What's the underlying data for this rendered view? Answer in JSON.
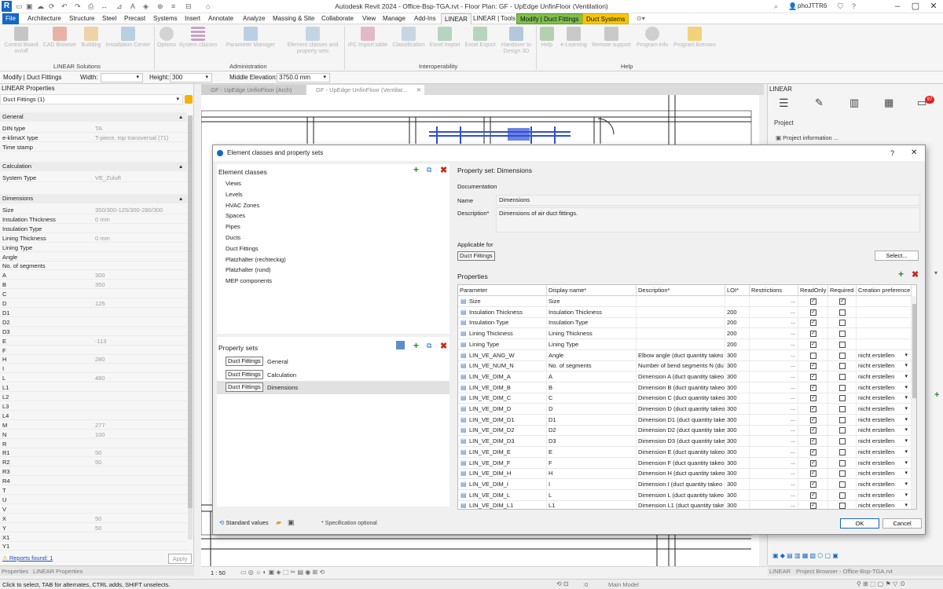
{
  "app": {
    "title": "Autodesk Revit 2024 - Office-Bsp-TGA.rvt - Floor Plan: GF - UpEdge UnfinFloor (Ventilation)",
    "user": "phoJTTR6"
  },
  "ribbon_tabs": [
    "File",
    "Architecture",
    "Structure",
    "Steel",
    "Precast",
    "Systems",
    "Insert",
    "Annotate",
    "Analyze",
    "Massing & Site",
    "Collaborate",
    "View",
    "Manage",
    "Add-Ins",
    "LINEAR",
    "LINEAR | Tools",
    "Modify | Duct Fittings",
    "Duct Systems"
  ],
  "ribbon": {
    "buttons": [
      {
        "label": "Control Board on/off",
        "icon": "control-board-icon"
      },
      {
        "label": "CAD Browser",
        "icon": "cad-browser-icon"
      },
      {
        "label": "Building",
        "icon": "building-icon"
      },
      {
        "label": "Installation Center",
        "icon": "installation-center-icon"
      },
      {
        "label": "Options",
        "icon": "gear-icon"
      },
      {
        "label": "System classes",
        "icon": "system-classes-icon"
      },
      {
        "label": "Parameter Manager",
        "icon": "parameter-manager-icon"
      },
      {
        "label": "Element classes and property sets",
        "icon": "element-classes-icon"
      },
      {
        "label": "IFC Import table",
        "icon": "ifc-import-icon"
      },
      {
        "label": "Classification",
        "icon": "classification-icon"
      },
      {
        "label": "Excel Import",
        "icon": "excel-import-icon"
      },
      {
        "label": "Excel Export",
        "icon": "excel-export-icon"
      },
      {
        "label": "Handover to Design 3D",
        "icon": "handover-icon"
      },
      {
        "label": "Help",
        "icon": "help-icon"
      },
      {
        "label": "e-Learning",
        "icon": "e-learning-icon"
      },
      {
        "label": "Remote support",
        "icon": "remote-support-icon"
      },
      {
        "label": "Program info",
        "icon": "info-icon"
      },
      {
        "label": "Program licenses",
        "icon": "key-icon"
      }
    ],
    "panels": [
      "LINEAR Solutions",
      "Administration",
      "Interoperability",
      "Help"
    ]
  },
  "options_bar": {
    "context": "Modify | Duct Fittings",
    "width_label": "Width:",
    "height_label": "Height:",
    "height_value": "300",
    "elev_label": "Middle Elevation:",
    "elev_value": "3750.0 mm"
  },
  "properties": {
    "header": "LINEAR Properties",
    "type_selector": "Duct Fittings (1)",
    "sections": {
      "general": "General",
      "calculation": "Calculation",
      "dimensions": "Dimensions"
    },
    "general_rows": [
      {
        "k": "DIN type",
        "v": "TA"
      },
      {
        "k": "e-klimaX type",
        "v": "T-piece, top transversal (71)"
      },
      {
        "k": "Time stamp",
        "v": ""
      }
    ],
    "calc_rows": [
      {
        "k": "System Type",
        "v": "VE_Zuluft"
      }
    ],
    "dim_rows": [
      {
        "k": "Size",
        "v": "350/300-125/300-280/300"
      },
      {
        "k": "Insulation Thickness",
        "v": "0 mm"
      },
      {
        "k": "Insulation Type",
        "v": ""
      },
      {
        "k": "Lining Thickness",
        "v": "0 mm"
      },
      {
        "k": "Lining Type",
        "v": ""
      },
      {
        "k": "Angle",
        "v": ""
      },
      {
        "k": "No. of segments",
        "v": ""
      },
      {
        "k": "A",
        "v": "300"
      },
      {
        "k": "B",
        "v": "350"
      },
      {
        "k": "C",
        "v": ""
      },
      {
        "k": "D",
        "v": "125"
      },
      {
        "k": "D1",
        "v": ""
      },
      {
        "k": "D2",
        "v": ""
      },
      {
        "k": "D3",
        "v": ""
      },
      {
        "k": "E",
        "v": "-113"
      },
      {
        "k": "F",
        "v": ""
      },
      {
        "k": "H",
        "v": "280"
      },
      {
        "k": "I",
        "v": ""
      },
      {
        "k": "L",
        "v": "480"
      },
      {
        "k": "L1",
        "v": ""
      },
      {
        "k": "L2",
        "v": ""
      },
      {
        "k": "L3",
        "v": ""
      },
      {
        "k": "L4",
        "v": ""
      },
      {
        "k": "M",
        "v": "277"
      },
      {
        "k": "N",
        "v": "100"
      },
      {
        "k": "R",
        "v": ""
      },
      {
        "k": "R1",
        "v": "50"
      },
      {
        "k": "R2",
        "v": "50"
      },
      {
        "k": "R3",
        "v": ""
      },
      {
        "k": "R4",
        "v": ""
      },
      {
        "k": "T",
        "v": ""
      },
      {
        "k": "U",
        "v": ""
      },
      {
        "k": "V",
        "v": ""
      },
      {
        "k": "X",
        "v": "50"
      },
      {
        "k": "Y",
        "v": "50"
      },
      {
        "k": "X1",
        "v": ""
      },
      {
        "k": "Y1",
        "v": ""
      }
    ],
    "reports": "Reports found: 1",
    "apply": "Apply",
    "bottom_tabs": [
      "Properties",
      "LINEAR Properties"
    ]
  },
  "view_tabs": [
    "GF - UpEdge UnfinFloor (Arch)",
    "GF - UpEdge UnfinFloor (Ventilat..."
  ],
  "linear_panel": {
    "title": "LINEAR",
    "badge": "97",
    "project_label": "Project",
    "project_info": "Project information ...",
    "bottom_tabs": [
      "LINEAR",
      "Project Browser - Office-Bsp-TGA.rvt"
    ]
  },
  "status": {
    "text": "Click to select, TAB for alternates, CTRL adds, SHIFT unselects.",
    "scale": "1 : 50",
    "model": "Main Model",
    "count": ":0"
  },
  "dialog": {
    "title": "Element classes and property sets",
    "element_classes_label": "Element classes",
    "element_classes": [
      "Views",
      "Levels",
      "HVAC Zones",
      "Spaces",
      "Pipes",
      "Ducts",
      "Duct Fittings",
      "Platzhalter (rechteckig)",
      "Platzhalter (rund)",
      "MEP components"
    ],
    "property_sets_label": "Property sets",
    "property_sets": [
      {
        "chip": "Duct Fittings",
        "name": "General"
      },
      {
        "chip": "Duct Fittings",
        "name": "Calculation"
      },
      {
        "chip": "Duct Fittings",
        "name": "Dimensions"
      }
    ],
    "property_set_title": "Property set: Dimensions",
    "documentation_label": "Documentation",
    "name_label": "Name",
    "name_value": "Dimensions",
    "description_label": "Description*",
    "description_value": "Dimensions of air duct fittings.",
    "applicable_label": "Applicable for",
    "applicable_value": "Duct Fittings",
    "select_button": "Select...",
    "properties_label": "Properties",
    "columns": [
      "Parameter",
      "Display name*",
      "Description*",
      "LOI*",
      "Restrictions",
      "ReadOnly",
      "Required",
      "Creation preference"
    ],
    "rows": [
      {
        "param": "Size",
        "display": "Size",
        "desc": "",
        "loi": "",
        "ro": true,
        "req": true,
        "pref": ""
      },
      {
        "param": "Insulation Thickness",
        "display": "Insulation Thickness",
        "desc": "",
        "loi": "200",
        "ro": true,
        "req": false,
        "pref": ""
      },
      {
        "param": "Insulation Type",
        "display": "Insulation Type",
        "desc": "",
        "loi": "200",
        "ro": true,
        "req": false,
        "pref": ""
      },
      {
        "param": "Lining Thickness",
        "display": "Lining Thickness",
        "desc": "",
        "loi": "200",
        "ro": true,
        "req": false,
        "pref": ""
      },
      {
        "param": "Lining Type",
        "display": "Lining Type",
        "desc": "",
        "loi": "200",
        "ro": true,
        "req": false,
        "pref": ""
      },
      {
        "param": "LIN_VE_ANG_W",
        "display": "Angle",
        "desc": "Elbow angle (duct quantity takeo",
        "loi": "300",
        "ro": false,
        "req": false,
        "pref": "nicht erstellen"
      },
      {
        "param": "LIN_VE_NUM_N",
        "display": "No. of segments",
        "desc": "Number of bend segments N (du",
        "loi": "300",
        "ro": true,
        "req": false,
        "pref": "nicht erstellen"
      },
      {
        "param": "LIN_VE_DIM_A",
        "display": "A",
        "desc": "Dimension A (duct quantity takeo",
        "loi": "300",
        "ro": true,
        "req": false,
        "pref": "nicht erstellen"
      },
      {
        "param": "LIN_VE_DIM_B",
        "display": "B",
        "desc": "Dimension B (duct quantity takeo",
        "loi": "300",
        "ro": true,
        "req": false,
        "pref": "nicht erstellen"
      },
      {
        "param": "LIN_VE_DIM_C",
        "display": "C",
        "desc": "Dimension C (duct quantity takeo",
        "loi": "300",
        "ro": true,
        "req": false,
        "pref": "nicht erstellen"
      },
      {
        "param": "LIN_VE_DIM_D",
        "display": "D",
        "desc": "Dimension D (duct quantity takeo",
        "loi": "300",
        "ro": true,
        "req": false,
        "pref": "nicht erstellen"
      },
      {
        "param": "LIN_VE_DIM_D1",
        "display": "D1",
        "desc": "Dimension D1 (duct quantity take",
        "loi": "300",
        "ro": true,
        "req": false,
        "pref": "nicht erstellen"
      },
      {
        "param": "LIN_VE_DIM_D2",
        "display": "D2",
        "desc": "Dimension D2 (duct quantity take",
        "loi": "300",
        "ro": true,
        "req": false,
        "pref": "nicht erstellen"
      },
      {
        "param": "LIN_VE_DIM_D3",
        "display": "D3",
        "desc": "Dimension D3 (duct quantity take",
        "loi": "300",
        "ro": true,
        "req": false,
        "pref": "nicht erstellen"
      },
      {
        "param": "LIN_VE_DIM_E",
        "display": "E",
        "desc": "Dimension E (duct quantity takeo",
        "loi": "300",
        "ro": true,
        "req": false,
        "pref": "nicht erstellen"
      },
      {
        "param": "LIN_VE_DIM_F",
        "display": "F",
        "desc": "Dimension F (duct quantity takeo",
        "loi": "300",
        "ro": true,
        "req": false,
        "pref": "nicht erstellen"
      },
      {
        "param": "LIN_VE_DIM_H",
        "display": "H",
        "desc": "Dimension H (duct quantity takeo",
        "loi": "300",
        "ro": true,
        "req": false,
        "pref": "nicht erstellen"
      },
      {
        "param": "LIN_VE_DIM_I",
        "display": "I",
        "desc": "Dimension I (duct quantity takeo",
        "loi": "300",
        "ro": true,
        "req": false,
        "pref": "nicht erstellen"
      },
      {
        "param": "LIN_VE_DIM_L",
        "display": "L",
        "desc": "Dimension L (duct quantity takeo",
        "loi": "300",
        "ro": true,
        "req": false,
        "pref": "nicht erstellen"
      },
      {
        "param": "LIN_VE_DIM_L1",
        "display": "L1",
        "desc": "Dimension L1 (duct quantity take",
        "loi": "300",
        "ro": true,
        "req": false,
        "pref": "nicht erstellen"
      }
    ],
    "standard_values": "Standard values",
    "spec_note": "* Specification optional",
    "ok": "OK",
    "cancel": "Cancel",
    "help": "?",
    "close": "✕"
  },
  "colors": {
    "accent": "#1567c5",
    "context_green": "#7ec04a",
    "context_yellow": "#f7c600",
    "duct_blue": "#2f4fd6"
  }
}
